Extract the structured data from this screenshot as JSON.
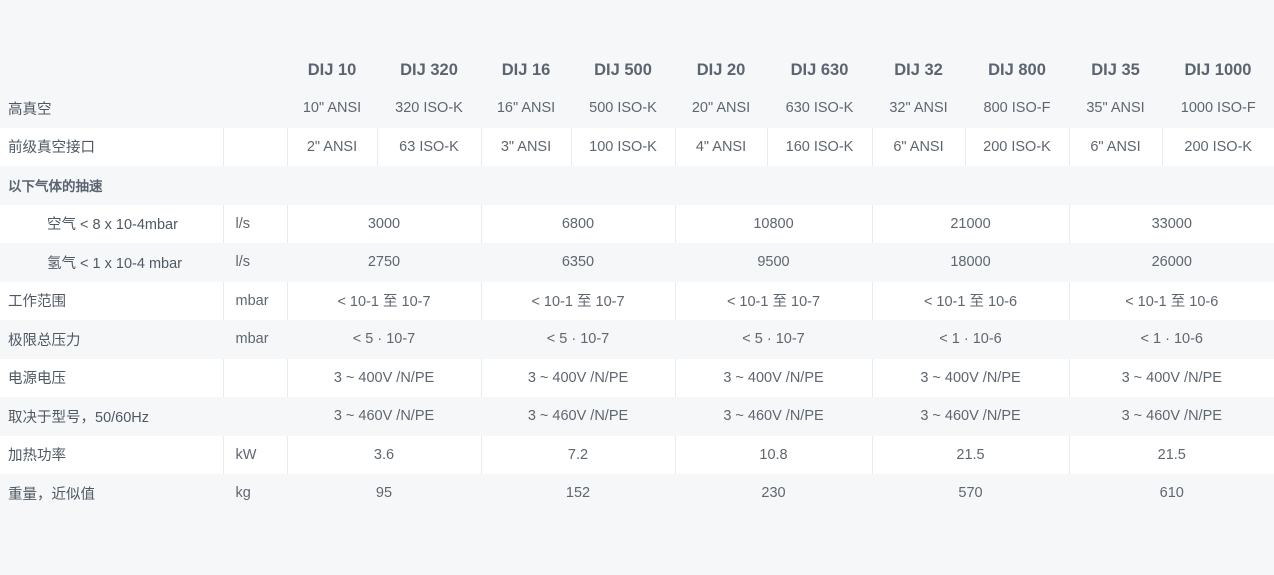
{
  "models": [
    "DIJ 10",
    "DIJ 320",
    "DIJ 16",
    "DIJ 500",
    "DIJ 20",
    "DIJ 630",
    "DIJ 32",
    "DIJ 800",
    "DIJ 35",
    "DIJ 1000"
  ],
  "rows": {
    "high_vacuum": {
      "label": "高真空",
      "values": [
        "10\" ANSI",
        "320 ISO-K",
        "16\" ANSI",
        "500 ISO-K",
        "20\" ANSI",
        "630 ISO-K",
        "32\" ANSI",
        "800 ISO-F",
        "35\" ANSI",
        "1000 ISO-F"
      ]
    },
    "foreline": {
      "label": "前级真空接口",
      "values": [
        "2\" ANSI",
        "63 ISO-K",
        "3\" ANSI",
        "100 ISO-K",
        "4\" ANSI",
        "160 ISO-K",
        "6\" ANSI",
        "200 ISO-K",
        "6\" ANSI",
        "200 ISO-K"
      ]
    },
    "pumping_speed_header": {
      "label": "以下气体的抽速"
    },
    "air": {
      "label": "空气 < 8 x 10-4mbar",
      "unit": "l/s",
      "values": [
        "3000",
        "6800",
        "10800",
        "21000",
        "33000"
      ]
    },
    "hydrogen": {
      "label": "氢气 < 1 x 10-4 mbar",
      "unit": "l/s",
      "values": [
        "2750",
        "6350",
        "9500",
        "18000",
        "26000"
      ]
    },
    "working_range": {
      "label": "工作范围",
      "unit": "mbar",
      "values": [
        "< 10-1 至 10-7",
        "< 10-1 至 10-7",
        "< 10-1 至 10-7",
        "< 10-1 至 10-6",
        "< 10-1 至 10-6"
      ]
    },
    "ultimate_pressure": {
      "label": "极限总压力",
      "unit": "mbar",
      "values": [
        "< 5 · 10-7",
        "< 5 · 10-7",
        "< 5 · 10-7",
        "< 1 · 10-6",
        "< 1 · 10-6"
      ]
    },
    "supply_voltage": {
      "label": "电源电压",
      "values": [
        "3 ~ 400V /N/PE",
        "3 ~ 400V /N/PE",
        "3 ~ 400V /N/PE",
        "3 ~ 400V /N/PE",
        "3 ~ 400V /N/PE"
      ]
    },
    "model_dependent": {
      "label": "取决于型号，50/60Hz",
      "values": [
        "3 ~ 460V /N/PE",
        "3 ~ 460V /N/PE",
        "3 ~ 460V /N/PE",
        "3 ~ 460V /N/PE",
        "3 ~ 460V /N/PE"
      ]
    },
    "heating_power": {
      "label": "加热功率",
      "unit": "kW",
      "values": [
        "3.6",
        "7.2",
        "10.8",
        "21.5",
        "21.5"
      ]
    },
    "weight": {
      "label": "重量，近似值",
      "unit": "kg",
      "values": [
        "95",
        "152",
        "230",
        "570",
        "610"
      ]
    }
  }
}
